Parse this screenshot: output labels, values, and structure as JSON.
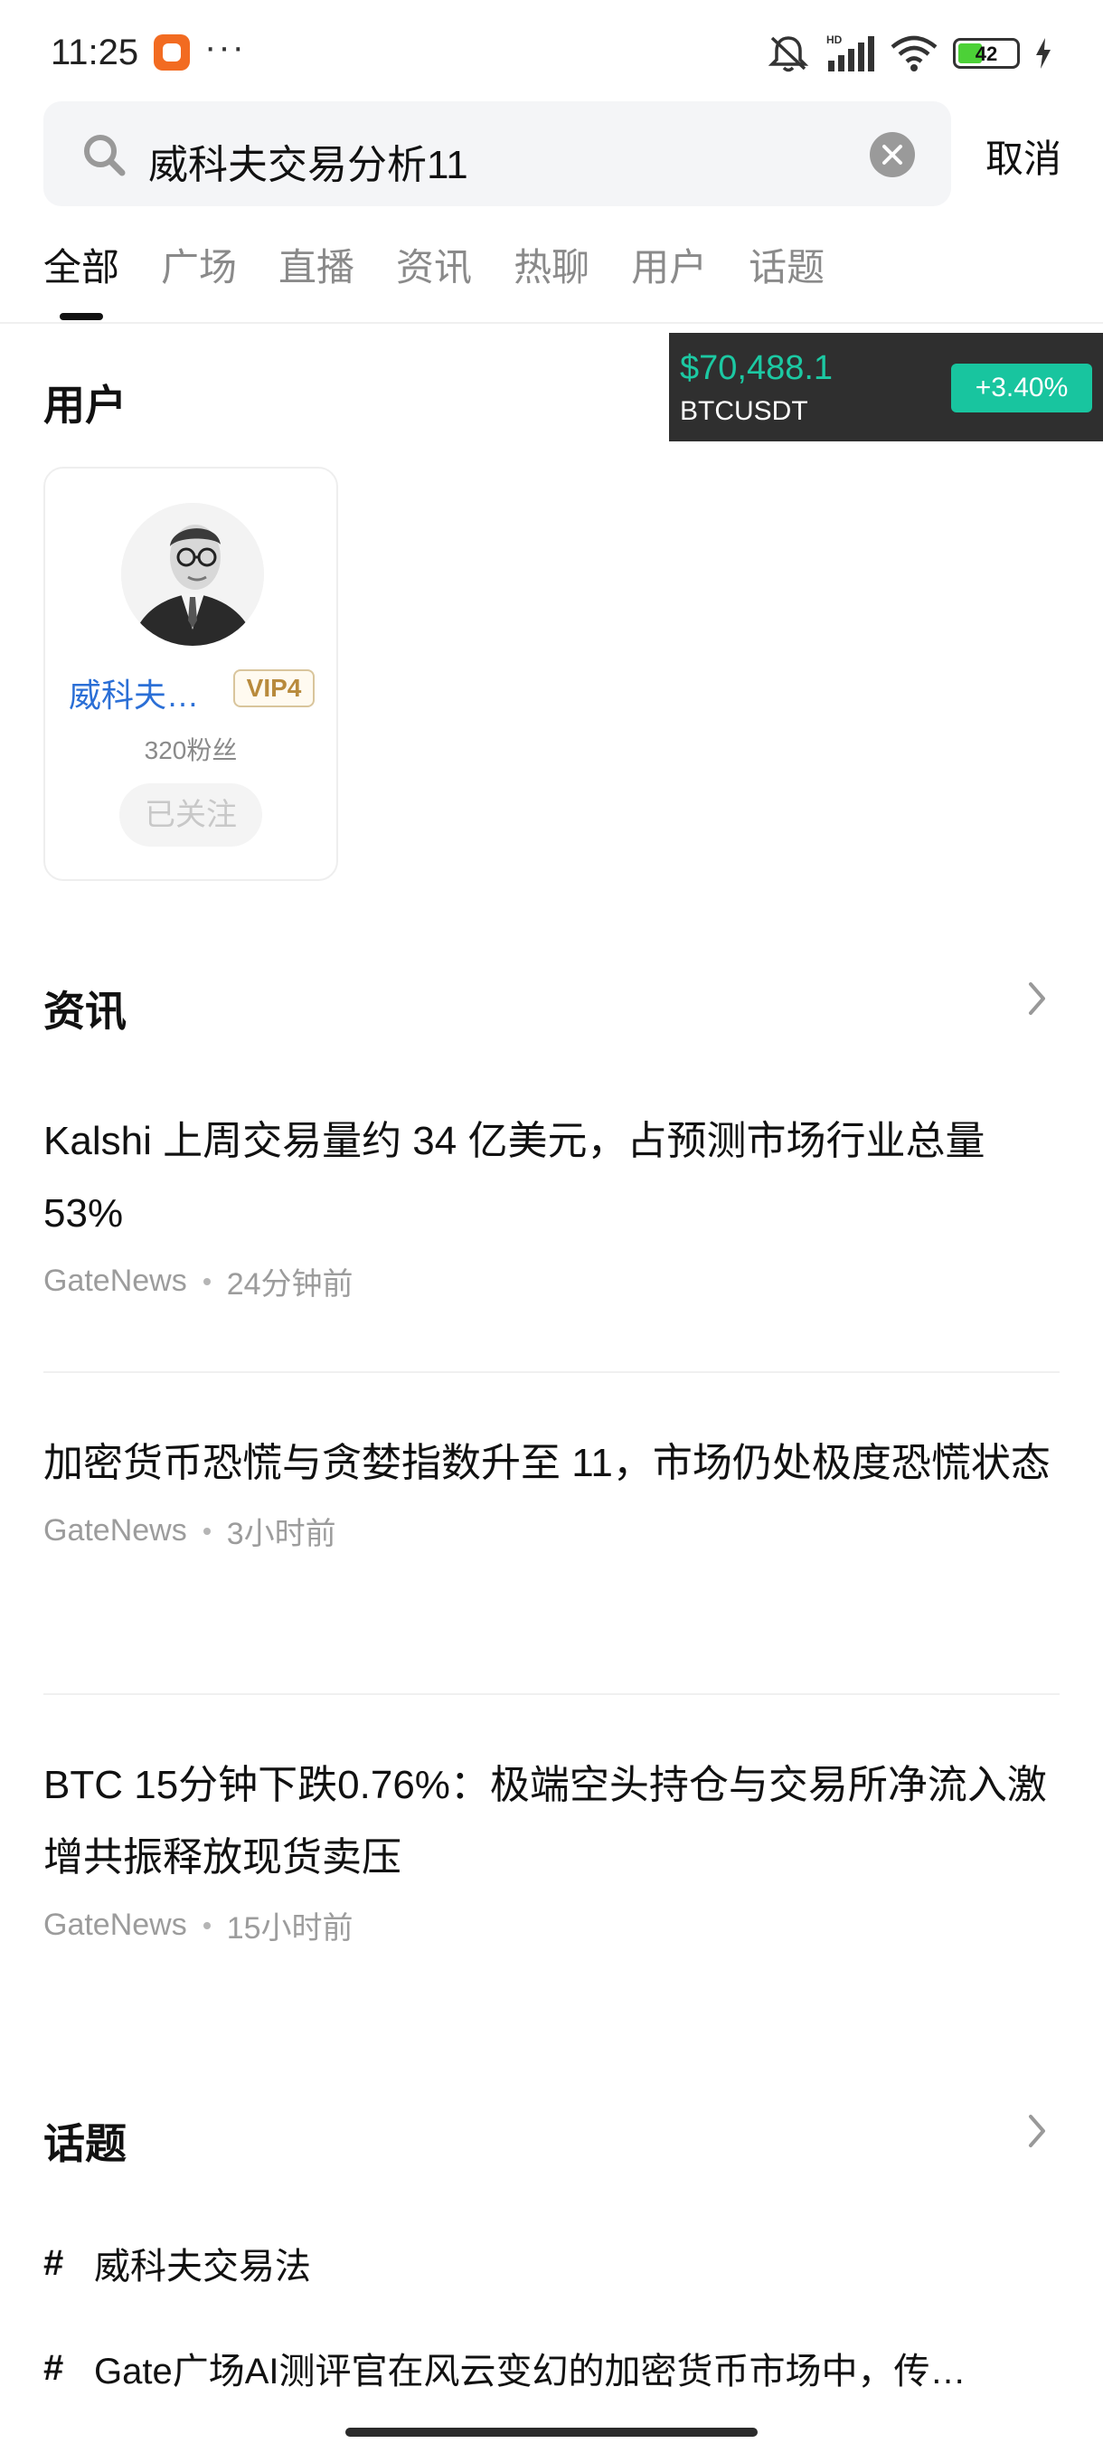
{
  "status_bar": {
    "time": "11:25",
    "dots": "···",
    "battery_level": "42",
    "battery_fraction": 0.42,
    "icons": [
      "app-icon",
      "mute-icon",
      "hd-signal-icon",
      "wifi-icon",
      "battery-icon",
      "charging-icon"
    ]
  },
  "search": {
    "query": "威科夫交易分析11",
    "cancel_label": "取消"
  },
  "tabs": [
    {
      "label": "全部",
      "active": true
    },
    {
      "label": "广场",
      "active": false
    },
    {
      "label": "直播",
      "active": false
    },
    {
      "label": "资讯",
      "active": false
    },
    {
      "label": "热聊",
      "active": false
    },
    {
      "label": "用户",
      "active": false
    },
    {
      "label": "话题",
      "active": false
    }
  ],
  "ticker": {
    "price": "$70,488.1",
    "pair": "BTCUSDT",
    "change": "+3.40%"
  },
  "users_section": {
    "title": "用户",
    "user": {
      "name": "威科夫…",
      "vip": "VIP4",
      "fans": "320粉丝",
      "follow_label": "已关注"
    }
  },
  "news_section": {
    "title": "资讯",
    "items": [
      {
        "title": "Kalshi 上周交易量约 34 亿美元，占预测市场行业总量 53%",
        "source": "GateNews",
        "time": "24分钟前"
      },
      {
        "title": "加密货币恐慌与贪婪指数升至 11，市场仍处极度恐慌状态",
        "source": "GateNews",
        "time": "3小时前"
      },
      {
        "title": "BTC 15分钟下跌0.76%：极端空头持仓与交易所净流入激增共振释放现货卖压",
        "source": "GateNews",
        "time": "15小时前"
      }
    ]
  },
  "topics_section": {
    "title": "话题",
    "items": [
      {
        "hash": "#",
        "text": "威科夫交易法"
      },
      {
        "hash": "#",
        "text": "Gate广场AI测评官在风云变幻的加密货币市场中，传…"
      }
    ]
  },
  "colors": {
    "accent_green": "#18c59f",
    "link_blue": "#2b6fd6",
    "vip_gold": "#b88a3c"
  }
}
